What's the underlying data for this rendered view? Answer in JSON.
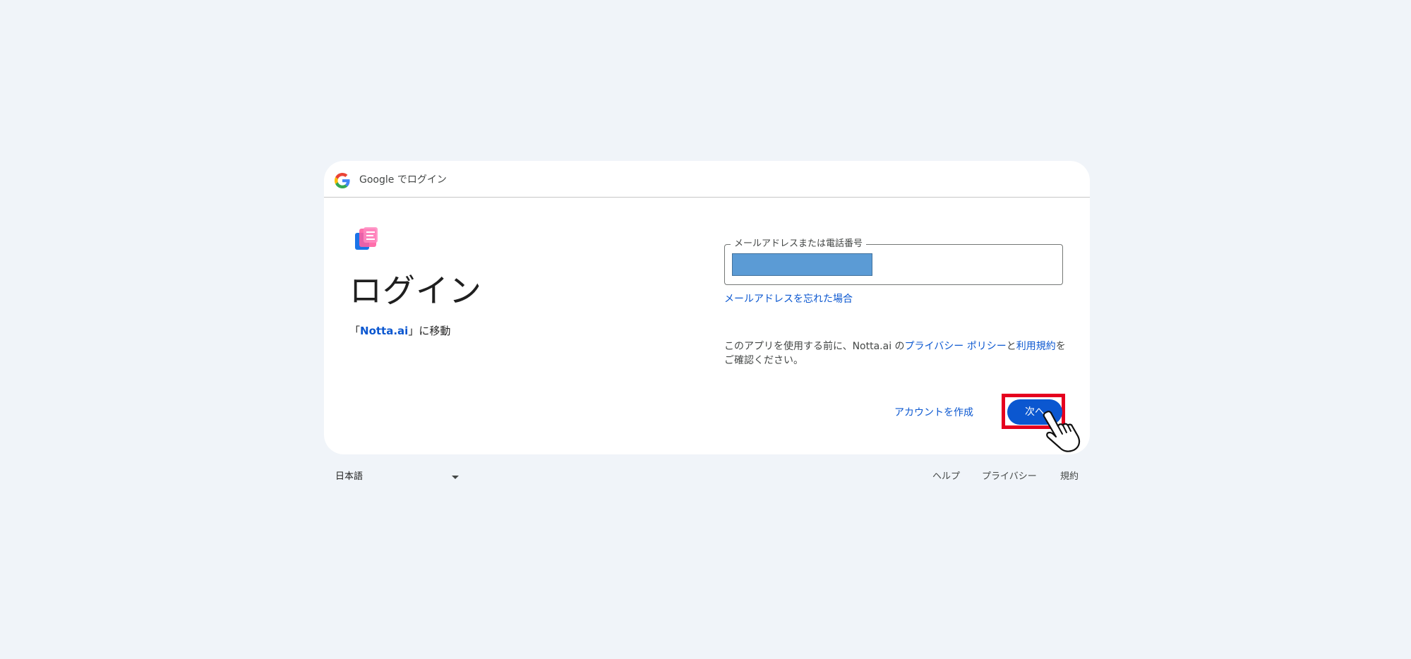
{
  "header": {
    "title": "Google でログイン",
    "logo_icon": "google-g-icon"
  },
  "app": {
    "logo_icon": "notta-logo-icon",
    "title": "ログイン",
    "subtitle_prefix": "「",
    "subtitle_link": "Notta.ai",
    "subtitle_suffix": "」に移動"
  },
  "email_field": {
    "label": "メールアドレスまたは電話番号",
    "value_redacted": true
  },
  "forgot_email": "メールアドレスを忘れた場合",
  "disclaimer": {
    "before": "このアプリを使用する前に、Notta.ai の",
    "privacy_link": "プライバシー ポリシー",
    "middle": "と",
    "terms_link": "利用規約",
    "after": "をご確認ください。"
  },
  "actions": {
    "create_account": "アカウントを作成",
    "next": "次へ"
  },
  "footer": {
    "language": "日本語",
    "help": "ヘルプ",
    "privacy": "プライバシー",
    "terms": "規約"
  },
  "colors": {
    "background": "#f0f4f9",
    "link": "#0b57d0",
    "primary_button": "#0b57d0",
    "highlight": "#e5001e",
    "redaction": "#5b9bd5"
  }
}
